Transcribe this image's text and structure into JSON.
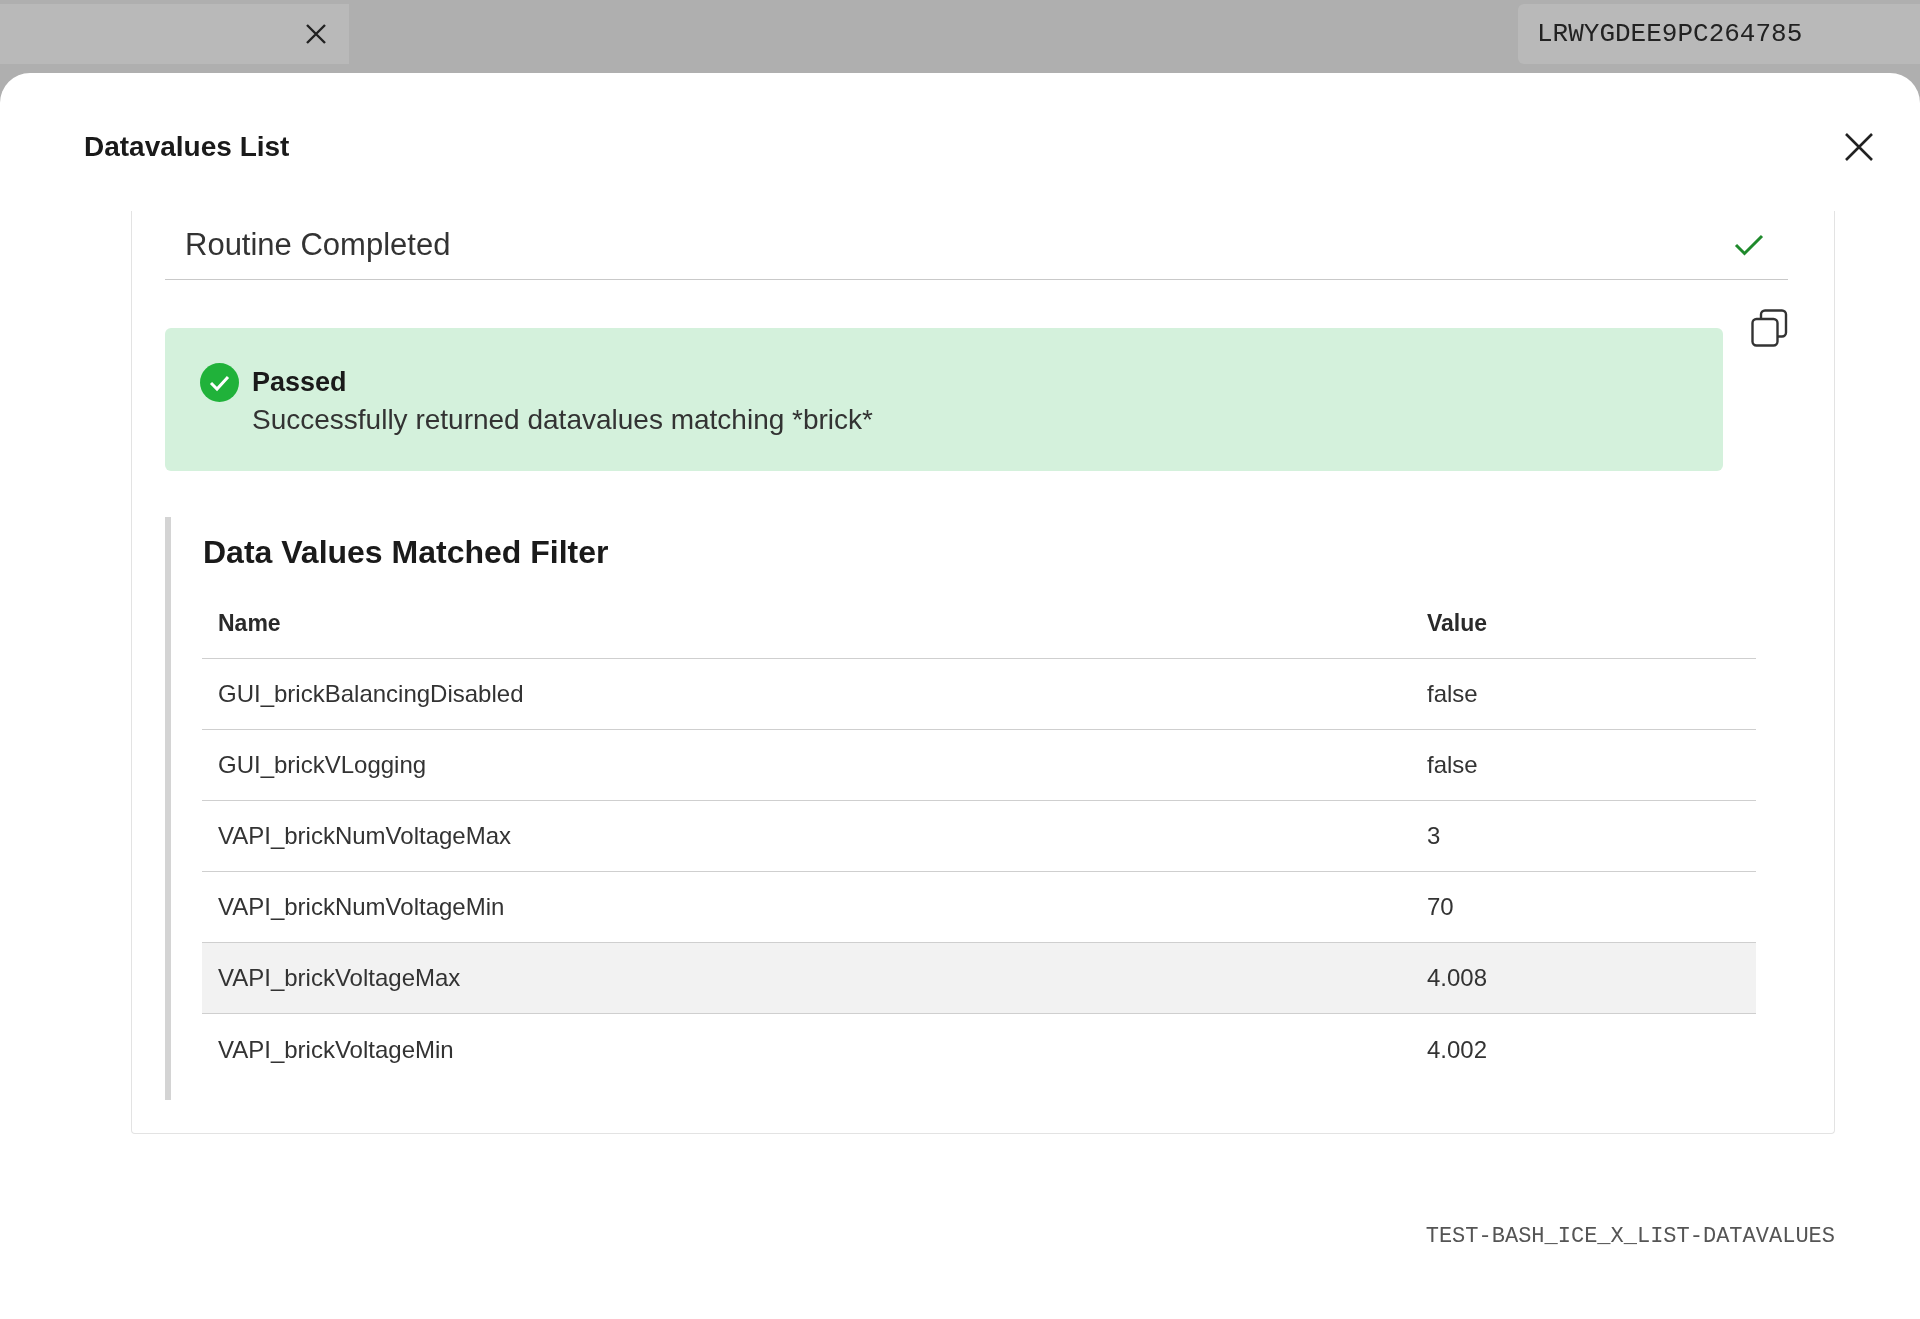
{
  "top_strip": {
    "tab_label": "LRWYGDEE9PC264785"
  },
  "modal": {
    "title": "Datavalues List"
  },
  "routine": {
    "label": "Routine Completed",
    "completed": true
  },
  "alert": {
    "kind": "success",
    "title": "Passed",
    "message": "Successfully returned datavalues matching *brick*"
  },
  "results": {
    "title": "Data Values Matched Filter",
    "columns": [
      "Name",
      "Value"
    ],
    "rows": [
      {
        "name": "GUI_brickBalancingDisabled",
        "value": "false",
        "highlighted": false
      },
      {
        "name": "GUI_brickVLogging",
        "value": "false",
        "highlighted": false
      },
      {
        "name": "VAPI_brickNumVoltageMax",
        "value": "3",
        "highlighted": false
      },
      {
        "name": "VAPI_brickNumVoltageMin",
        "value": "70",
        "highlighted": false
      },
      {
        "name": "VAPI_brickVoltageMax",
        "value": "4.008",
        "highlighted": true
      },
      {
        "name": "VAPI_brickVoltageMin",
        "value": "4.002",
        "highlighted": false
      }
    ]
  },
  "footer": {
    "code": "TEST-BASH_ICE_X_LIST-DATAVALUES"
  }
}
